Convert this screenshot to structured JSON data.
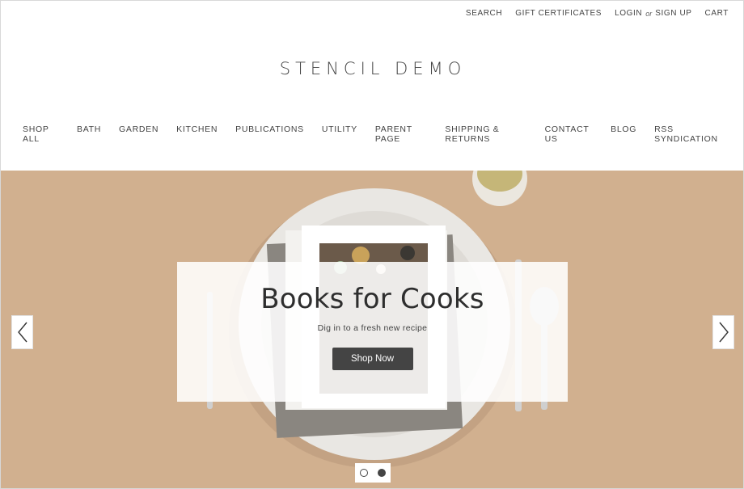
{
  "utility_nav": {
    "search": "SEARCH",
    "gift_certificates": "GIFT CERTIFICATES",
    "login": "LOGIN",
    "or": "or",
    "sign_up": "SIGN UP",
    "cart": "CART"
  },
  "logo": "STENCIL DEMO",
  "main_nav": [
    {
      "label": "SHOP ALL"
    },
    {
      "label": "BATH"
    },
    {
      "label": "GARDEN"
    },
    {
      "label": "KITCHEN"
    },
    {
      "label": "PUBLICATIONS"
    },
    {
      "label": "UTILITY"
    },
    {
      "label": "PARENT PAGE"
    },
    {
      "label": "SHIPPING & RETURNS"
    },
    {
      "label": "CONTACT US"
    },
    {
      "label": "BLOG"
    },
    {
      "label": "RSS SYNDICATION"
    }
  ],
  "hero": {
    "title": "Books for Cooks",
    "subtitle": "Dig in to a fresh new recipe",
    "button": "Shop Now",
    "prev_icon": "chevron-left-icon",
    "next_icon": "chevron-right-icon",
    "slide_count": 2,
    "active_slide": 2
  },
  "colors": {
    "hero_bg": "#d1b08f",
    "button_bg": "#444444",
    "text": "#333333"
  }
}
